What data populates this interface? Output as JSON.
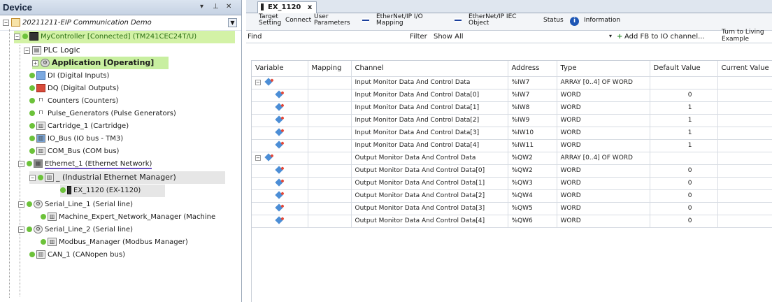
{
  "device_panel": {
    "title": "Device",
    "controls": {
      "dropdown": "▾",
      "pin": "⊥",
      "close": "✕"
    },
    "project_name": "20211211-EIP Communication Demo",
    "tree": {
      "controller": "MyController [Connected] (TM241CEC24T/U)",
      "plc_logic": "PLC Logic",
      "application": "Application [Operating]",
      "di": "DI (Digital Inputs)",
      "dq": "DQ (Digital Outputs)",
      "counters": "Counters (Counters)",
      "pulse": "Pulse_Generators (Pulse Generators)",
      "cartridge": "Cartridge_1 (Cartridge)",
      "io_bus": "IO_Bus (IO bus - TM3)",
      "com_bus": "COM_Bus (COM bus)",
      "ethernet": "Ethernet_1 (Ethernet Network)",
      "industrial_eth": "_ (Industrial Ethernet Manager)",
      "ex_1120": "EX_1120 (EX-1120)",
      "serial1": "Serial_Line_1 (Serial line)",
      "machine_expert": "Machine_Expert_Network_Manager (Machine",
      "serial2": "Serial_Line_2 (Serial line)",
      "modbus": "Modbus_Manager (Modbus Manager)",
      "can": "CAN_1 (CANopen bus)"
    }
  },
  "editor": {
    "doc_tab": "EX_1120",
    "doc_tab_close": "x",
    "subtabs": {
      "target_setting_1": "Target",
      "target_setting_2": "Setting",
      "connect": "Connect",
      "user_params_1": "User",
      "user_params_2": "Parameters",
      "eip_io_1": "EtherNet/IP I/O",
      "eip_io_2": "Mapping",
      "eip_iec_1": "EtherNet/IP IEC",
      "eip_iec_2": "Object",
      "status": "Status",
      "information": "Information",
      "info_icon": "i"
    },
    "toolbar": {
      "find": "Find",
      "filter": "Filter",
      "show_all": "Show All",
      "add_fb": "Add FB to IO channel...",
      "turn_to_1": "Turn to Living",
      "turn_to_2": "Example"
    },
    "columns": [
      "Variable",
      "Mapping",
      "Channel",
      "Address",
      "Type",
      "Default Value",
      "Current Value"
    ],
    "rows": [
      {
        "channel": "Input Monitor Data And Control Data",
        "address": "%IW7",
        "type": "ARRAY [0..4] OF WORD",
        "default": "",
        "group": true
      },
      {
        "channel": "Input Monitor Data And Control Data[0]",
        "address": "%IW7",
        "type": "WORD",
        "default": "0"
      },
      {
        "channel": "Input Monitor Data And Control Data[1]",
        "address": "%IW8",
        "type": "WORD",
        "default": "1"
      },
      {
        "channel": "Input Monitor Data And Control Data[2]",
        "address": "%IW9",
        "type": "WORD",
        "default": "1"
      },
      {
        "channel": "Input Monitor Data And Control Data[3]",
        "address": "%IW10",
        "type": "WORD",
        "default": "1"
      },
      {
        "channel": "Input Monitor Data And Control Data[4]",
        "address": "%IW11",
        "type": "WORD",
        "default": "1"
      },
      {
        "channel": "Output Monitor Data And Control Data",
        "address": "%QW2",
        "type": "ARRAY [0..4] OF WORD",
        "default": "",
        "group": true
      },
      {
        "channel": "Output Monitor Data And Control Data[0]",
        "address": "%QW2",
        "type": "WORD",
        "default": "0"
      },
      {
        "channel": "Output Monitor Data And Control Data[1]",
        "address": "%QW3",
        "type": "WORD",
        "default": "0"
      },
      {
        "channel": "Output Monitor Data And Control Data[2]",
        "address": "%QW4",
        "type": "WORD",
        "default": "0"
      },
      {
        "channel": "Output Monitor Data And Control Data[3]",
        "address": "%QW5",
        "type": "WORD",
        "default": "0"
      },
      {
        "channel": "Output Monitor Data And Control Data[4]",
        "address": "%QW6",
        "type": "WORD",
        "default": "0"
      }
    ]
  },
  "colors": {
    "selected_row": "#d3f2a6",
    "status_dot": "#6cc23a",
    "header_bg": "#c6d2e3"
  }
}
